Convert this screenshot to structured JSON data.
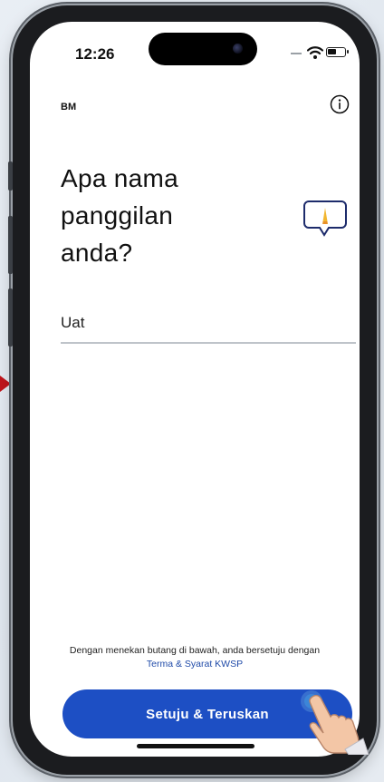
{
  "status_bar": {
    "time": "12:26"
  },
  "header": {
    "language_label": "BM"
  },
  "main": {
    "question_lines": [
      "Apa nama",
      "panggilan",
      "anda?"
    ],
    "nickname_value": "Uat"
  },
  "footer": {
    "consent_text": "Dengan menekan butang di bawah, anda bersetuju dengan",
    "terms_link": "Terma & Syarat KWSP",
    "button_label": "Setuju & Teruskan"
  },
  "icons": {
    "info": "info-icon",
    "chat": "chat-bubble-icon",
    "wifi": "wifi-icon",
    "battery": "battery-icon"
  },
  "colors": {
    "primary_button": "#1d4fc4",
    "link": "#1f4aa8",
    "pointer_indicator": "#c0141b"
  }
}
